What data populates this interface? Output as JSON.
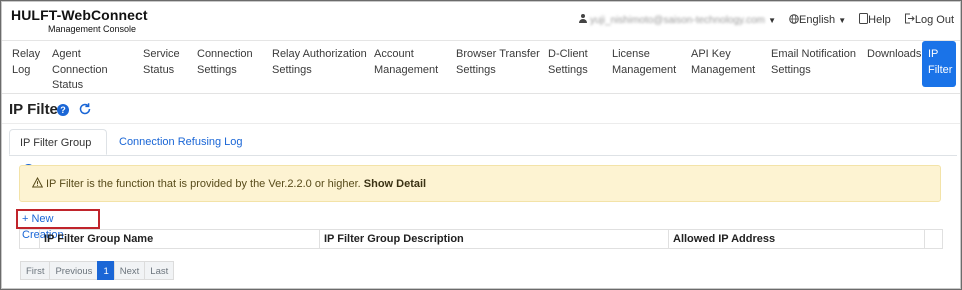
{
  "brand": {
    "title": "HULFT-WebConnect",
    "subtitle": "Management Console"
  },
  "user_menu": {
    "email": "yuji_nishimoto@saison-technology.com",
    "language": "English",
    "help": "Help",
    "logout": "Log Out"
  },
  "nav": [
    {
      "lines": [
        "Relay",
        "Log"
      ]
    },
    {
      "lines": [
        "Agent",
        "Connection",
        "Status"
      ]
    },
    {
      "lines": [
        "Service",
        "Status"
      ]
    },
    {
      "lines": [
        "Connection",
        "Settings"
      ]
    },
    {
      "lines": [
        "Relay Authorization",
        "Settings"
      ]
    },
    {
      "lines": [
        "Account",
        "Management"
      ]
    },
    {
      "lines": [
        "Browser Transfer",
        "Settings"
      ]
    },
    {
      "lines": [
        "D-Client",
        "Settings"
      ]
    },
    {
      "lines": [
        "License",
        "Management"
      ]
    },
    {
      "lines": [
        "API Key",
        "Management"
      ]
    },
    {
      "lines": [
        "Email Notification",
        "Settings"
      ]
    },
    {
      "lines": [
        "Downloads"
      ]
    },
    {
      "lines": [
        "IP",
        "Filter"
      ]
    }
  ],
  "page_title": "IP Filter",
  "help_mark": "?",
  "tabs": {
    "active": "IP Filter Group",
    "other": "Connection Refusing Log"
  },
  "alert": {
    "text": "IP Filter is the function that is provided by the Ver.2.2.0 or higher.",
    "link": "Show Detail"
  },
  "new_creation": "+ New Creation",
  "table_headers": [
    "IP Filter Group Name",
    "IP Filter Group Description",
    "Allowed IP Address"
  ],
  "pagination": {
    "first": "First",
    "previous": "Previous",
    "current": "1",
    "next": "Next",
    "last": "Last"
  },
  "colors": {
    "accent": "#1a73e8",
    "link": "#1a66d6",
    "alert_bg": "#fdf3d2",
    "highlight_border": "#c0242b"
  },
  "icons": [
    "user-icon",
    "globe-icon",
    "help-icon",
    "logout-icon",
    "refresh-icon",
    "warning-icon"
  ]
}
